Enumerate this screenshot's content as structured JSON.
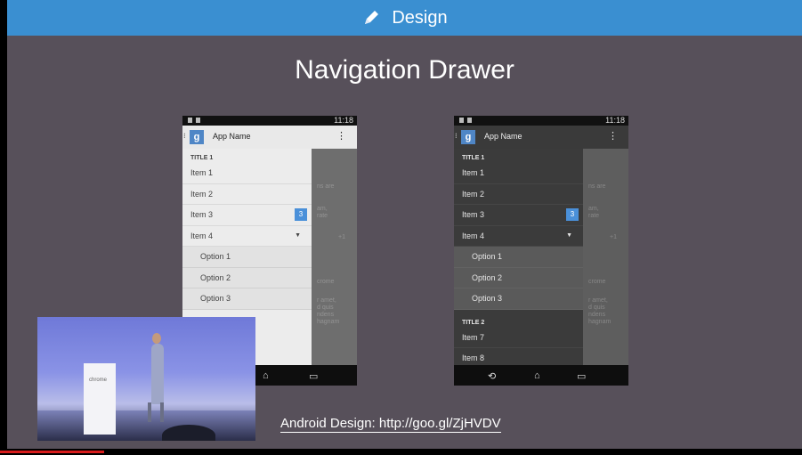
{
  "header": {
    "title": "Design",
    "icon": "pencil-icon",
    "color": "#3a8fd1"
  },
  "slide": {
    "title": "Navigation Drawer",
    "link_text": "Android Design: http://goo.gl/ZjHVDV",
    "background": "#57505a"
  },
  "phones": {
    "light": {
      "time": "11:18",
      "app_name": "App Name",
      "title1": "TITLE 1",
      "items": [
        "Item 1",
        "Item 2",
        "Item 3",
        "Item 4"
      ],
      "badge": "3",
      "options": [
        "Option 1",
        "Option 2",
        "Option 3"
      ]
    },
    "dark": {
      "time": "11:18",
      "app_name": "App Name",
      "title1": "TITLE 1",
      "items": [
        "Item 1",
        "Item 2",
        "Item 3",
        "Item 4"
      ],
      "badge": "3",
      "options": [
        "Option 1",
        "Option 2",
        "Option 3"
      ],
      "title2": "TITLE 2",
      "items2": [
        "Item 7",
        "Item 8"
      ]
    }
  },
  "video": {
    "podium_label": "chrome"
  },
  "player": {
    "progress_fraction": 0.13,
    "progress_color": "#d91c1c"
  }
}
